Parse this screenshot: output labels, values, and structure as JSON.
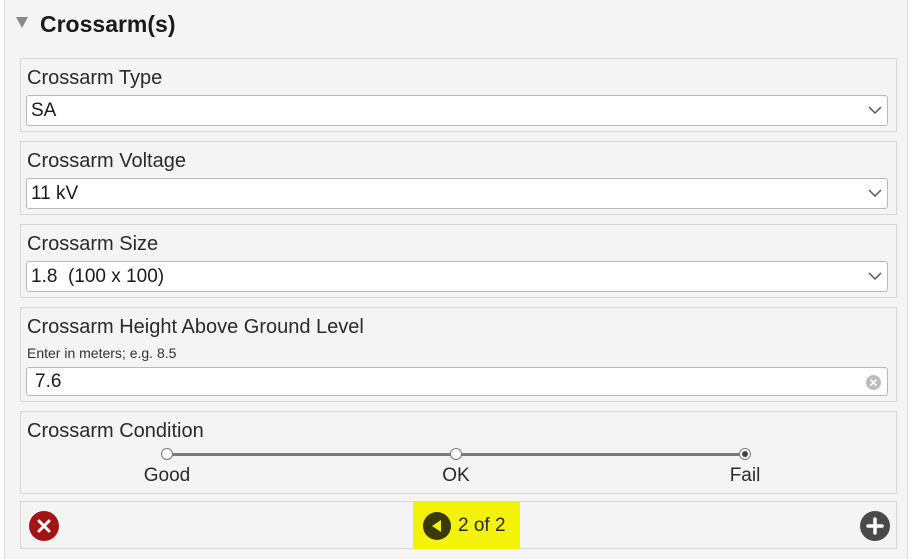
{
  "section": {
    "title": "Crossarm(s)"
  },
  "fields": {
    "type": {
      "label": "Crossarm Type",
      "value": "SA"
    },
    "voltage": {
      "label": "Crossarm Voltage",
      "value": "11 kV"
    },
    "size": {
      "label": "Crossarm Size",
      "value": "1.8  (100 x 100)"
    },
    "height": {
      "label": "Crossarm Height Above Ground Level",
      "hint": "Enter in meters; e.g. 8.5",
      "value": "7.6"
    },
    "condition": {
      "label": "Crossarm Condition",
      "options": [
        "Good",
        "OK",
        "Fail"
      ],
      "selected": "Fail"
    }
  },
  "footer": {
    "pager_text": "2 of 2"
  },
  "colors": {
    "delete": "#a31515",
    "add": "#4a4a4a",
    "pager_highlight": "#f2f20a"
  }
}
